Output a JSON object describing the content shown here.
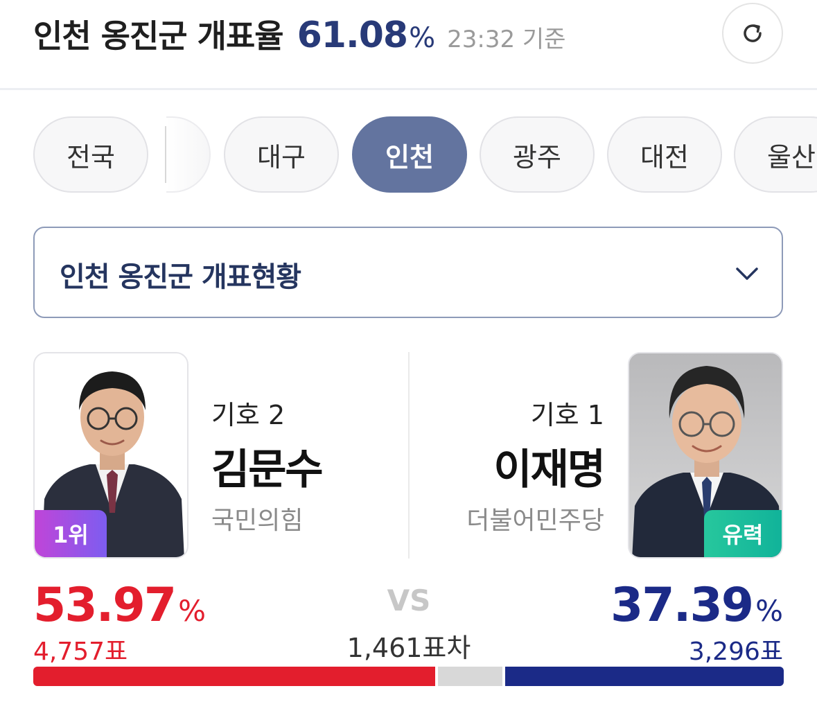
{
  "header": {
    "title": "인천 옹진군 개표율",
    "rate": "61.08",
    "rate_unit": "%",
    "time": "23:32 기준",
    "refresh_icon": "refresh-icon"
  },
  "tabs": [
    {
      "label": "전국",
      "active": false
    },
    {
      "label": "대구",
      "active": false
    },
    {
      "label": "인천",
      "active": true
    },
    {
      "label": "광주",
      "active": false
    },
    {
      "label": "대전",
      "active": false
    },
    {
      "label": "울산",
      "active": false
    }
  ],
  "dropdown": {
    "label": "인천 옹진군 개표현황",
    "icon": "chevron-down-icon"
  },
  "candidates": {
    "left": {
      "number": "기호 2",
      "name": "김문수",
      "party": "국민의힘",
      "badge": "1위",
      "percent": "53.97",
      "percent_unit": "%",
      "votes": "4,757표",
      "color": "#e31e2d"
    },
    "right": {
      "number": "기호 1",
      "name": "이재명",
      "party": "더불어민주당",
      "badge": "유력",
      "percent": "37.39",
      "percent_unit": "%",
      "votes": "3,296표",
      "color": "#1b2a87"
    }
  },
  "comparison": {
    "vs": "VS",
    "difference": "1,461표차"
  },
  "bar": {
    "left_share": 53.97,
    "other_share": 8.64,
    "right_share": 37.39
  },
  "colors": {
    "accent": "#283a78",
    "active_tab": "#63749f",
    "strong_badge": "#27c79d",
    "rank_badge": "#9a4fe4"
  }
}
